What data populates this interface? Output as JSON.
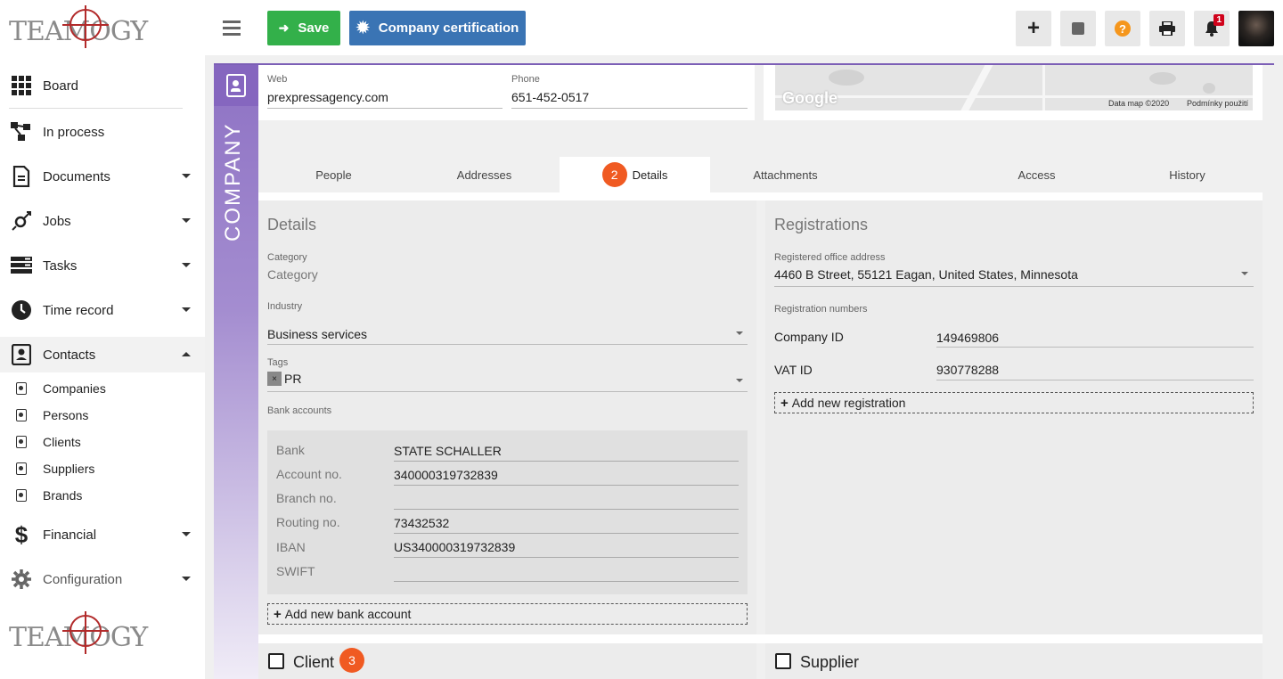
{
  "app": {
    "logo_text": "TEAMOGY"
  },
  "sidebar": {
    "items": [
      {
        "label": "Board",
        "icon": "grid-icon"
      },
      {
        "label": "In process",
        "icon": "process-icon"
      },
      {
        "label": "Documents",
        "icon": "document-icon"
      },
      {
        "label": "Jobs",
        "icon": "jobs-icon"
      },
      {
        "label": "Tasks",
        "icon": "tasks-icon"
      },
      {
        "label": "Time record",
        "icon": "clock-icon"
      },
      {
        "label": "Contacts",
        "icon": "contacts-icon"
      },
      {
        "label": "Financial",
        "icon": "dollar-icon"
      },
      {
        "label": "Configuration",
        "icon": "gear-icon"
      }
    ],
    "contacts_sub": [
      {
        "label": "Companies"
      },
      {
        "label": "Persons"
      },
      {
        "label": "Clients"
      },
      {
        "label": "Suppliers"
      },
      {
        "label": "Brands"
      }
    ]
  },
  "toolbar": {
    "save_label": "Save",
    "cert_label": "Company certification",
    "notifications_count": "1"
  },
  "company": {
    "band_label": "COMPANY",
    "web_label": "Web",
    "web_value": "prexpressagency.com",
    "phone_label": "Phone",
    "phone_value": "651-452-0517"
  },
  "map": {
    "provider": "Google",
    "copyright": "Data map ©2020",
    "terms": "Podmínky použití"
  },
  "tabs": [
    {
      "label": "People"
    },
    {
      "label": "Addresses"
    },
    {
      "label": "Details",
      "badge": "2"
    },
    {
      "label": "Attachments"
    },
    {
      "label": "Access"
    },
    {
      "label": "History"
    }
  ],
  "details": {
    "title": "Details",
    "category_label": "Category",
    "category_placeholder": "Category",
    "industry_label": "Industry",
    "industry_value": "Business services",
    "tags_label": "Tags",
    "tag_value": "PR",
    "tag_remove": "×",
    "bank_accounts_label": "Bank accounts",
    "bank": [
      {
        "label": "Bank",
        "value": "STATE SCHALLER"
      },
      {
        "label": "Account no.",
        "value": "340000319732839"
      },
      {
        "label": "Branch no.",
        "value": ""
      },
      {
        "label": "Routing no.",
        "value": "73432532"
      },
      {
        "label": "IBAN",
        "value": "US340000319732839"
      },
      {
        "label": "SWIFT",
        "value": ""
      }
    ],
    "add_bank_label": "Add new bank account"
  },
  "registrations": {
    "title": "Registrations",
    "office_label": "Registered office address",
    "office_value": "4460 B Street, 55121 Eagan, United States, Minnesota",
    "numbers_label": "Registration numbers",
    "company_id_label": "Company ID",
    "company_id_value": "149469806",
    "vat_id_label": "VAT ID",
    "vat_id_value": "930778288",
    "add_registration_label": "Add new registration"
  },
  "flags": {
    "client_label": "Client",
    "client_badge": "3",
    "client_checked": false,
    "supplier_label": "Supplier",
    "supplier_checked": false
  },
  "colors": {
    "save_green": "#33b04a",
    "cert_blue": "#3a74b4",
    "accent_purple": "#7c5fb6",
    "badge_orange": "#f05a22",
    "help_orange": "#f5961c"
  }
}
